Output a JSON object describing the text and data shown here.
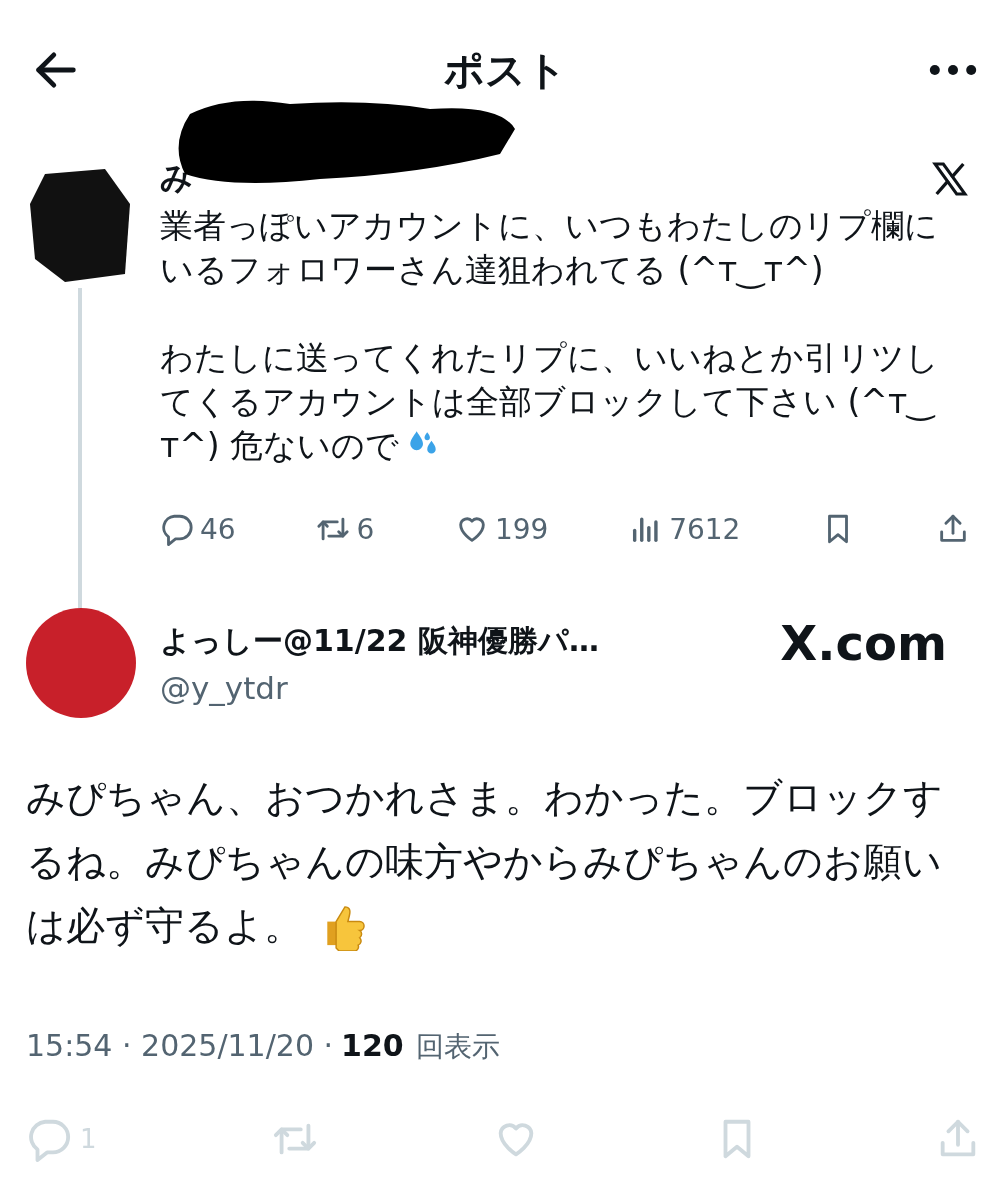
{
  "header": {
    "title": "ポスト"
  },
  "parent_post": {
    "name": "み",
    "paragraphs": [
      {
        "kind": "plain",
        "lines": [
          "業者っぽいアカウントに、いつもわたしのリプ欄に",
          "いるフォロワーさん達狙われてる (^ᴛ‿ᴛ^)"
        ]
      },
      {
        "kind": "droplets",
        "lines": [
          "わたしに送ってくれたリプに、いいねとか引リツし",
          "てくるアカウントは全部ブロックして下さい (^ᴛ‿",
          "ᴛ^) 危ないので"
        ]
      }
    ],
    "stats": [
      {
        "kind": "reply",
        "count": "46"
      },
      {
        "kind": "repost",
        "count": "6"
      },
      {
        "kind": "like",
        "count": "199"
      },
      {
        "kind": "views",
        "count": "7612"
      },
      {
        "kind": "bookmark"
      },
      {
        "kind": "share"
      }
    ]
  },
  "post": {
    "name": "よっしー@11/22 阪神優勝パ…",
    "handle": "@y_ytdr",
    "badge": "X.com",
    "body": {
      "kind": "thumbs-up",
      "lines": [
        "みぴちゃん、おつかれさま。わかった。ブロックす",
        "るね。みぴちゃんの味方やからみぴちゃんのお願い",
        "は必ず守るよ。"
      ]
    },
    "meta": "15:54 · 2025/11/20 ·",
    "views": "120",
    "views_label": "回表示",
    "actions": [
      {
        "kind": "reply",
        "count": "1"
      },
      {
        "kind": "repost"
      },
      {
        "kind": "like"
      },
      {
        "kind": "bookmark"
      },
      {
        "kind": "share"
      }
    ]
  }
}
